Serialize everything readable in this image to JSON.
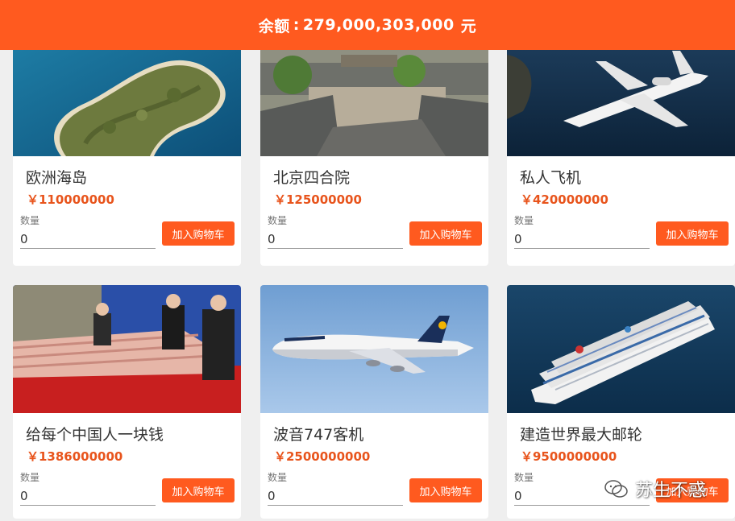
{
  "header": {
    "balance_label": "余额",
    "balance_sep": ":",
    "balance_value": "279,000,303,000",
    "balance_unit": "元",
    "bg_color": "#ff5a1f"
  },
  "products": [
    {
      "title": "欧洲海岛",
      "price": "￥110000000",
      "qty_label": "数量",
      "qty_value": "0",
      "button": "加入购物车"
    },
    {
      "title": "北京四合院",
      "price": "￥125000000",
      "qty_label": "数量",
      "qty_value": "0",
      "button": "加入购物车"
    },
    {
      "title": "私人飞机",
      "price": "￥420000000",
      "qty_label": "数量",
      "qty_value": "0",
      "button": "加入购物车"
    },
    {
      "title": "给每个中国人一块钱",
      "price": "￥1386000000",
      "qty_label": "数量",
      "qty_value": "0",
      "button": "加入购物车"
    },
    {
      "title": "波音747客机",
      "price": "￥2500000000",
      "qty_label": "数量",
      "qty_value": "0",
      "button": "加入购物车"
    },
    {
      "title": "建造世界最大邮轮",
      "price": "￥9500000000",
      "qty_label": "数量",
      "qty_value": "0",
      "button": "加入购物车"
    }
  ],
  "watermark": {
    "text": "苏生不惑",
    "icon": "wechat-icon"
  },
  "colors": {
    "accent": "#ff5a1f",
    "price": "#e8541c"
  }
}
